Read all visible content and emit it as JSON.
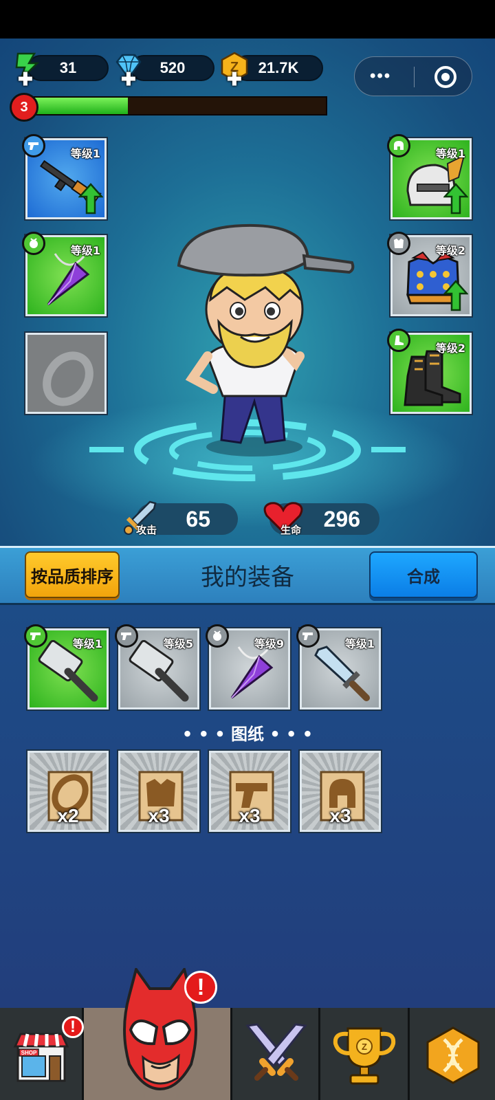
{
  "resources": {
    "energy": "31",
    "gems": "520",
    "coins": "21.7K"
  },
  "player": {
    "level": "3",
    "xp_fraction": 0.34
  },
  "equipped": {
    "weapon": {
      "level": "等级1",
      "icon": "rifle-icon",
      "upgradable": true
    },
    "necklace": {
      "level": "等级1",
      "icon": "amulet-icon",
      "upgradable": false
    },
    "ring": {
      "level": "",
      "icon": "ring-placeholder-icon",
      "upgradable": false
    },
    "helmet": {
      "level": "等级1",
      "icon": "helmet-icon",
      "upgradable": true
    },
    "armor": {
      "level": "等级2",
      "icon": "chest-armor-icon",
      "upgradable": true
    },
    "boots": {
      "level": "等级2",
      "icon": "boots-icon",
      "upgradable": false
    }
  },
  "stats": {
    "attack_label": "攻击",
    "attack": "65",
    "hp_label": "生命",
    "hp": "296"
  },
  "panel": {
    "sort_label": "按品质排序",
    "title": "我的装备",
    "craft_label": "合成"
  },
  "inventory": [
    {
      "level": "等级1",
      "icon": "hammer-icon",
      "rarity": "green"
    },
    {
      "level": "等级5",
      "icon": "hammer-icon",
      "rarity": "gray"
    },
    {
      "level": "等级9",
      "icon": "amulet-icon",
      "rarity": "gray"
    },
    {
      "level": "等级1",
      "icon": "sword-icon",
      "rarity": "gray"
    }
  ],
  "blueprints": {
    "title": "• • •  图纸  • • •",
    "items": [
      {
        "icon": "ring-blueprint-icon",
        "count": "x2"
      },
      {
        "icon": "armor-blueprint-icon",
        "count": "x3"
      },
      {
        "icon": "gun-blueprint-icon",
        "count": "x3"
      },
      {
        "icon": "helmet-blueprint-icon",
        "count": "x3"
      }
    ]
  },
  "nav": {
    "shop_label": "SHOP",
    "items": [
      "shop",
      "hero",
      "battle",
      "trophy",
      "dna"
    ]
  },
  "colors": {
    "xp_green": "#2fc21e",
    "gold": "#f2a40c",
    "blue_button": "#0b7ee6",
    "alert_red": "#e41a1a"
  }
}
